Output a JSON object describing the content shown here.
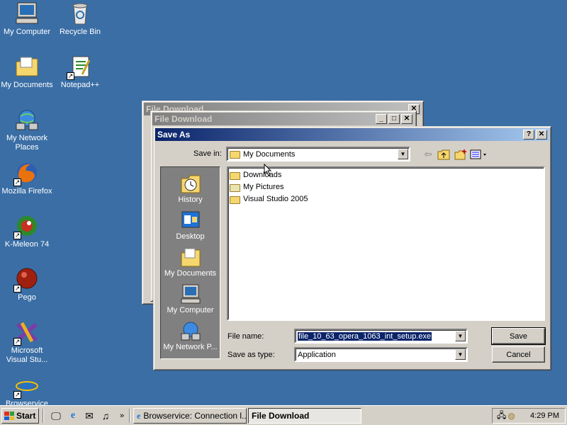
{
  "desktop": {
    "icons": [
      {
        "label": "My Computer",
        "icon": "computer-icon"
      },
      {
        "label": "Recycle Bin",
        "icon": "recycle-bin-icon"
      },
      {
        "label": "My Documents",
        "icon": "documents-folder-icon"
      },
      {
        "label": "Notepad++",
        "icon": "notepad-icon"
      },
      {
        "label": "My Network Places",
        "icon": "network-icon"
      },
      {
        "label": "Mozilla Firefox",
        "icon": "firefox-icon"
      },
      {
        "label": "K-Meleon 74",
        "icon": "kmeleon-icon"
      },
      {
        "label": "Pego",
        "icon": "pego-icon"
      },
      {
        "label": "Microsoft Visual Stu...",
        "icon": "visual-studio-icon"
      },
      {
        "label": "Browservice",
        "icon": "ie-icon"
      }
    ]
  },
  "background_windows": [
    {
      "title": "File Download"
    },
    {
      "title": "File Download"
    }
  ],
  "dialog": {
    "title": "Save As",
    "save_in_label": "Save in:",
    "save_in_value": "My Documents",
    "places": [
      {
        "label": "History",
        "icon": "history-icon"
      },
      {
        "label": "Desktop",
        "icon": "desktop-icon"
      },
      {
        "label": "My Documents",
        "icon": "documents-folder-icon"
      },
      {
        "label": "My Computer",
        "icon": "computer-icon"
      },
      {
        "label": "My Network P...",
        "icon": "network-icon"
      }
    ],
    "files": [
      {
        "name": "Downloads",
        "icon": "folder-icon"
      },
      {
        "name": "My Pictures",
        "icon": "pictures-folder-icon"
      },
      {
        "name": "Visual Studio 2005",
        "icon": "folder-icon"
      }
    ],
    "file_name_label": "File name:",
    "file_name_value": "file_10_63_opera_1063_int_setup.exe",
    "save_type_label": "Save as type:",
    "save_type_value": "Application",
    "save_button": "Save",
    "cancel_button": "Cancel"
  },
  "taskbar": {
    "start_label": "Start",
    "chevron": "»",
    "tasks": [
      {
        "label": "Browservice: Connection l...",
        "active": false
      },
      {
        "label": "File Download",
        "active": true
      }
    ],
    "clock": "4:29 PM"
  },
  "colors": {
    "desktop": "#3a6ea5",
    "title_active": "#0a246a",
    "face": "#d4d0c8"
  }
}
